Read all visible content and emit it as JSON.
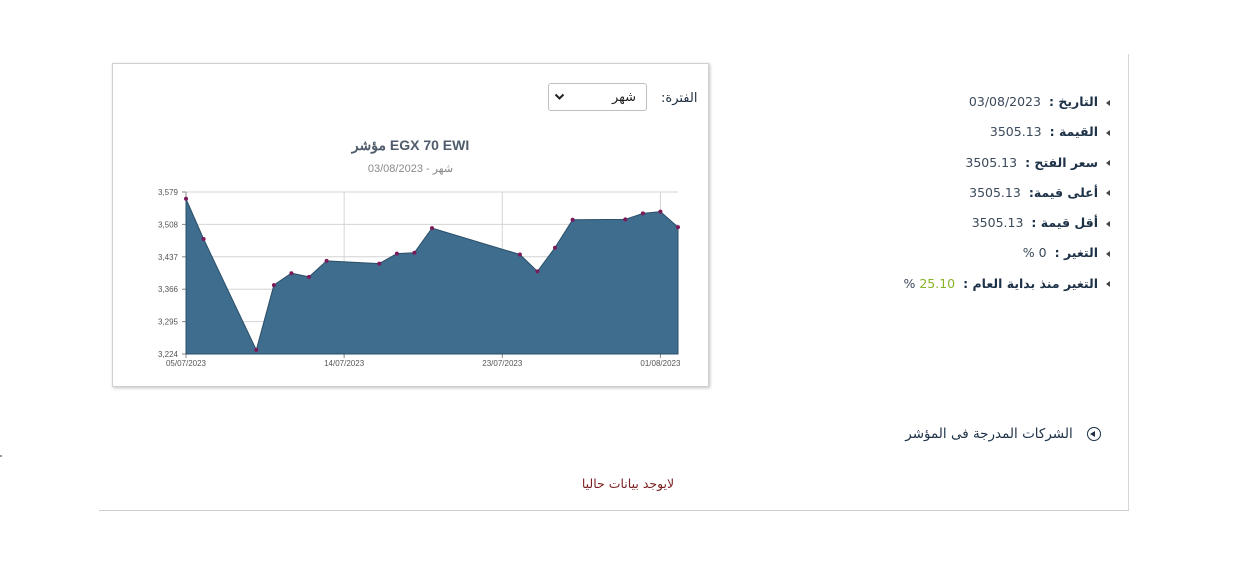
{
  "period": {
    "label": "الفترة:",
    "selected": "شهر"
  },
  "chart_data": {
    "type": "area",
    "title": "مؤشر EGX 70 EWI",
    "subtitle": "شهر - 03/08/2023",
    "ylim": [
      3224,
      3579
    ],
    "y_ticks": [
      "3,579",
      "3,508",
      "3,437",
      "3,366",
      "3,295",
      "3,224"
    ],
    "x_ticks": [
      "05/07/2023",
      "14/07/2023",
      "23/07/2023",
      "01/08/2023"
    ],
    "grid": true,
    "fill_color": "#3f6d8d",
    "marker_color": "#7b1a5a",
    "series": [
      {
        "values": [
          [
            0,
            3564
          ],
          [
            1,
            3476
          ],
          [
            4,
            3233
          ],
          [
            5,
            3375
          ],
          [
            6,
            3401
          ],
          [
            7,
            3393
          ],
          [
            8,
            3428
          ],
          [
            11,
            3422
          ],
          [
            12,
            3444
          ],
          [
            13,
            3446
          ],
          [
            14,
            3500
          ],
          [
            19,
            3442
          ],
          [
            20,
            3405
          ],
          [
            21,
            3457
          ],
          [
            22,
            3518
          ],
          [
            25,
            3519
          ],
          [
            26,
            3532
          ],
          [
            27,
            3536
          ],
          [
            28,
            3502
          ]
        ]
      }
    ]
  },
  "info": {
    "rows": [
      {
        "label": "التاريخ :",
        "value": "03/08/2023"
      },
      {
        "label": "القيمة :",
        "value": "3505.13"
      },
      {
        "label": "سعر الفتح :",
        "value": "3505.13"
      },
      {
        "label": "أعلى قيمة:",
        "value": "3505.13"
      },
      {
        "label": "أقل قيمة :",
        "value": "3505.13"
      },
      {
        "label": "التغير :",
        "value": "0",
        "suffix": "%"
      },
      {
        "label": "التغير منذ بداية العام :",
        "value": "25.10",
        "suffix": "%",
        "color": "#89b328"
      }
    ]
  },
  "companies": {
    "title": "الشركات المدرجة فى المؤشر"
  },
  "empty_message": "لايوجد بيانات حاليا"
}
